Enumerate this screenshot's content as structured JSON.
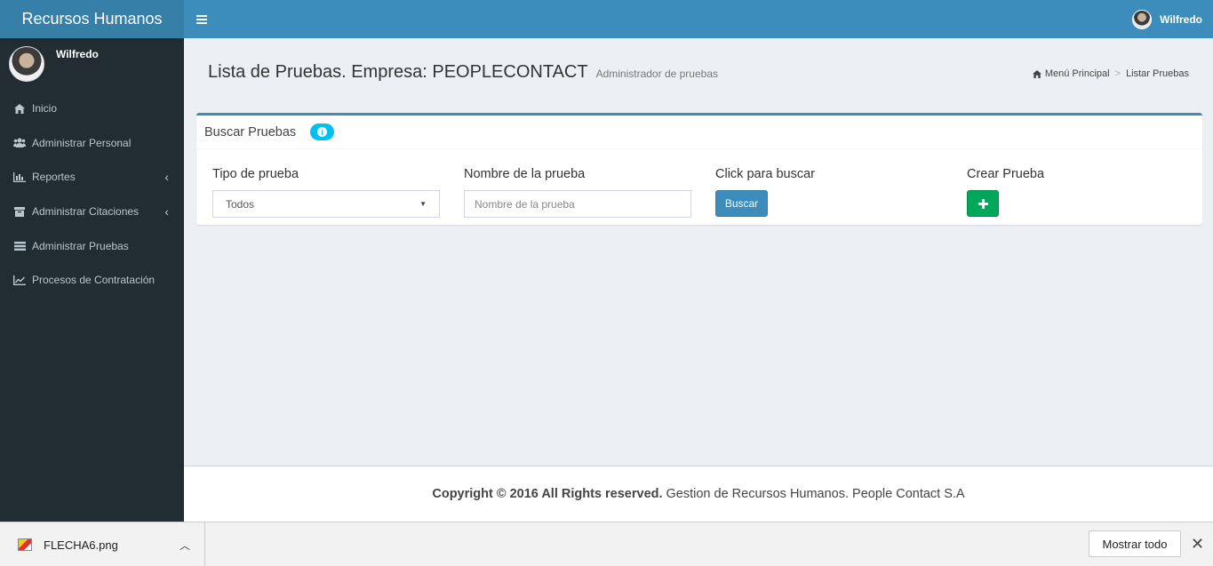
{
  "app": {
    "brand": "Recursos Humanos"
  },
  "navbar": {
    "user_name": "Wilfredo"
  },
  "sidebar": {
    "user_name": "Wilfredo",
    "items": [
      {
        "label": "Inicio",
        "icon": "home-icon",
        "has_submenu": false
      },
      {
        "label": "Administrar Personal",
        "icon": "users-icon",
        "has_submenu": false
      },
      {
        "label": "Reportes",
        "icon": "bar-chart-icon",
        "has_submenu": true
      },
      {
        "label": "Administrar Citaciones",
        "icon": "archive-icon",
        "has_submenu": true
      },
      {
        "label": "Administrar Pruebas",
        "icon": "list-icon",
        "has_submenu": false
      },
      {
        "label": "Procesos de Contratación",
        "icon": "line-chart-icon",
        "has_submenu": false
      }
    ]
  },
  "header": {
    "title": "Lista de Pruebas. Empresa: PEOPLECONTACT",
    "subtitle": "Administrador de pruebas",
    "breadcrumb": [
      "Menú Principal",
      "Listar Pruebas"
    ]
  },
  "search_box": {
    "title": "Buscar Pruebas",
    "type_label": "Tipo de prueba",
    "type_selected": "Todos",
    "name_label": "Nombre de la prueba",
    "name_value": "",
    "name_placeholder": "Nombre de la prueba",
    "search_label": "Click para buscar",
    "search_button": "Buscar",
    "create_label": "Crear Prueba"
  },
  "footer": {
    "bold": "Copyright © 2016 All Rights reserved.",
    "text": "Gestion de Recursos Humanos. People Contact S.A"
  },
  "download_bar": {
    "file_name": "FLECHA6.png",
    "show_all": "Mostrar todo"
  },
  "colors": {
    "header": "#3c8dbc",
    "logo": "#367fa9",
    "sidebar": "#222d32",
    "success": "#00a65a",
    "info": "#00c0ef"
  }
}
